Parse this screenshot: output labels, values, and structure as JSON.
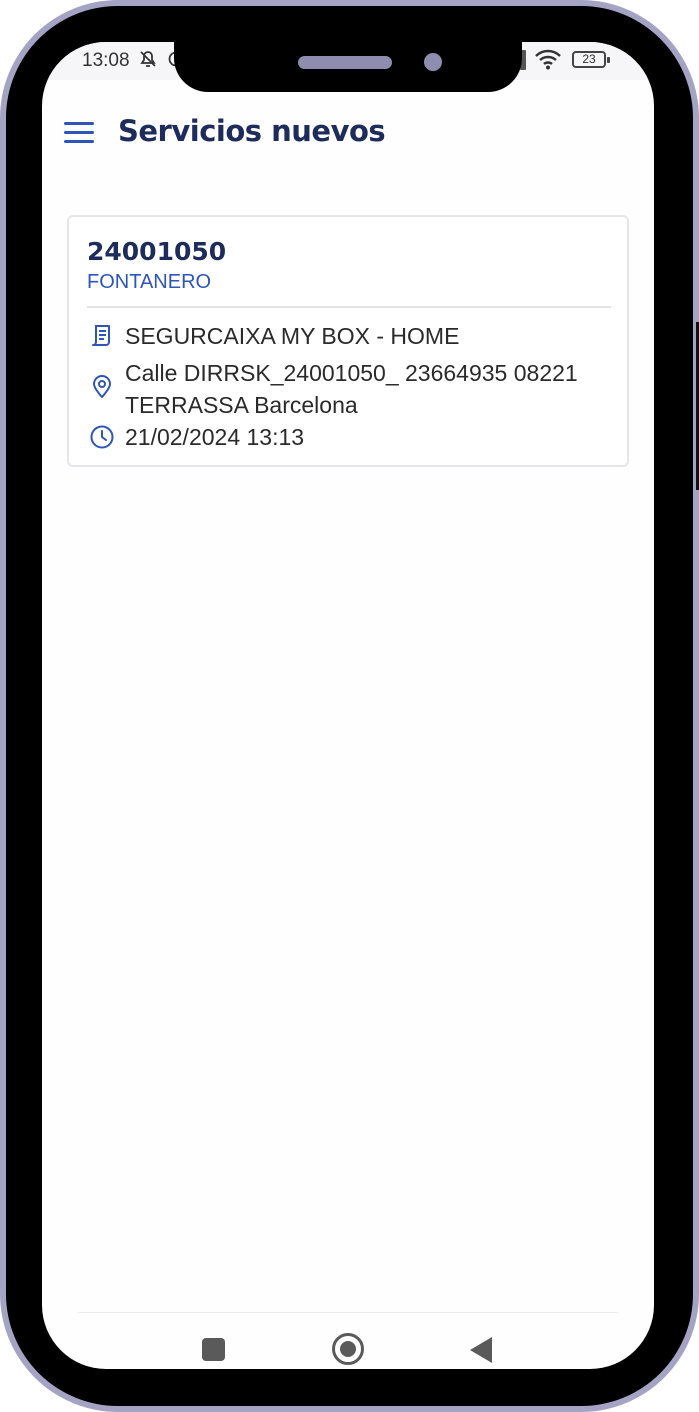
{
  "status_bar": {
    "time": "13:08",
    "mute_icon": "bell-off-icon",
    "alarm_icon": "alarm-icon",
    "battery": "23"
  },
  "app_bar": {
    "menu_icon": "hamburger-menu-icon",
    "title": "Servicios nuevos"
  },
  "services": [
    {
      "number": "24001050",
      "category": "FONTANERO",
      "client": "SEGURCAIXA MY BOX - HOME",
      "address": "Calle DIRRSK_24001050_ 23664935 08221 TERRASSA Barcelona",
      "datetime": "21/02/2024 13:13",
      "client_icon": "receipt-icon",
      "address_icon": "location-pin-icon",
      "datetime_icon": "clock-icon"
    }
  ],
  "nav": {
    "recents_icon": "square-recents-icon",
    "home_icon": "circle-home-icon",
    "back_icon": "triangle-back-icon"
  },
  "colors": {
    "accent": "#2f55b8",
    "title": "#1e2c5c",
    "frame": "#a5a3c4"
  }
}
